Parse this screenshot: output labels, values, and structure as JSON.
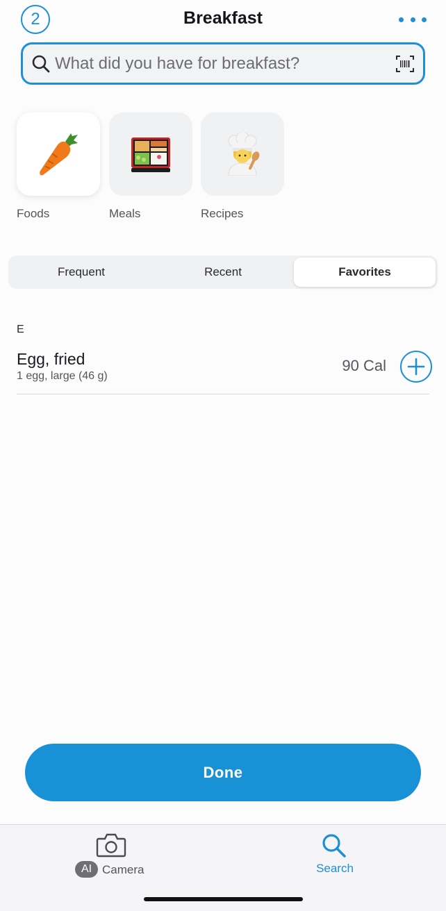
{
  "header": {
    "count_badge": "2",
    "title": "Breakfast",
    "more_icon": "more-horizontal-icon"
  },
  "search": {
    "placeholder": "What did you have for breakfast?",
    "icon": "search-icon",
    "barcode_icon": "barcode-scan-icon"
  },
  "categories": [
    {
      "label": "Foods",
      "icon": "carrot-icon",
      "selected": true
    },
    {
      "label": "Meals",
      "icon": "bento-box-icon",
      "selected": false
    },
    {
      "label": "Recipes",
      "icon": "chef-icon",
      "selected": false
    }
  ],
  "tabs": [
    {
      "label": "Frequent",
      "active": false
    },
    {
      "label": "Recent",
      "active": false
    },
    {
      "label": "Favorites",
      "active": true
    }
  ],
  "list": {
    "section_letter": "E",
    "items": [
      {
        "name": "Egg, fried",
        "serving": "1 egg, large (46 g)",
        "calories": "90 Cal"
      }
    ]
  },
  "done_label": "Done",
  "bottom_nav": {
    "ai_badge": "AI",
    "camera_label": "Camera",
    "search_label": "Search"
  },
  "colors": {
    "accent": "#1d8fd6",
    "done_button": "#1991d7"
  }
}
